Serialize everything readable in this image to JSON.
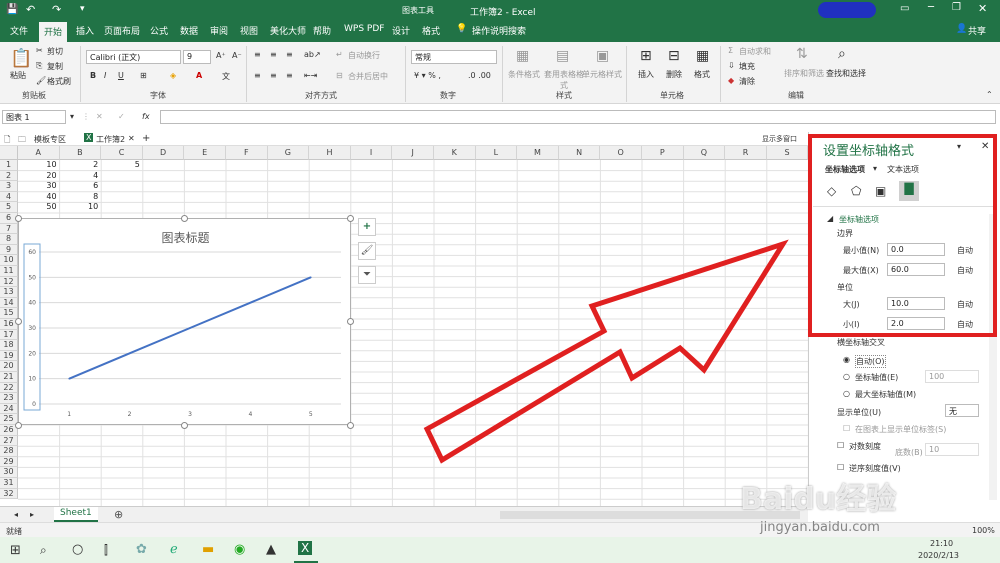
{
  "title": {
    "context_tab": "图表工具",
    "doc_title": "工作簿2 - Excel"
  },
  "tabs": [
    "文件",
    "开始",
    "插入",
    "页面布局",
    "公式",
    "数据",
    "审阅",
    "视图",
    "美化大师",
    "帮助",
    "WPS PDF",
    "设计",
    "格式",
    "操作说明搜索"
  ],
  "share": "共享",
  "ribbon": {
    "clipboard": {
      "paste": "粘贴",
      "cut": "剪切",
      "copy": "复制",
      "format_painter": "格式刷",
      "group": "剪贴板"
    },
    "font": {
      "name": "Calibri (正文)",
      "size": "9",
      "group": "字体"
    },
    "align": {
      "wrap": "自动换行",
      "merge": "合并后居中",
      "group": "对齐方式"
    },
    "number": {
      "format": "常规",
      "group": "数字"
    },
    "styles": {
      "conditional": "条件格式",
      "table": "套用表格格式",
      "cell": "单元格样式",
      "group": "样式"
    },
    "cells": {
      "insert": "插入",
      "delete": "删除",
      "format": "格式",
      "group": "单元格"
    },
    "edit": {
      "autosum": "自动求和",
      "fill": "填充",
      "clear": "清除",
      "sort": "排序和筛选",
      "find": "查找和选择",
      "group": "编辑"
    }
  },
  "formula": {
    "namebox": "图表 1",
    "fx": "fx"
  },
  "doctabs": {
    "template": "模板专区",
    "book": "工作簿2",
    "show_pane": "显示多窗口"
  },
  "columns": [
    "A",
    "B",
    "C",
    "D",
    "E",
    "F",
    "G",
    "H",
    "I",
    "J",
    "K",
    "L",
    "M",
    "N",
    "O",
    "P",
    "Q",
    "R",
    "S"
  ],
  "rows": [
    "1",
    "2",
    "3",
    "4",
    "5",
    "6",
    "7",
    "8",
    "9",
    "10",
    "11",
    "12",
    "13",
    "14",
    "15",
    "16",
    "17",
    "18",
    "19",
    "20",
    "21",
    "22",
    "23",
    "24",
    "25",
    "26",
    "27",
    "28",
    "29",
    "30",
    "31",
    "32"
  ],
  "cells": [
    {
      "r": 1,
      "c": 0,
      "v": "10"
    },
    {
      "r": 1,
      "c": 1,
      "v": "2"
    },
    {
      "r": 1,
      "c": 2,
      "v": "5"
    },
    {
      "r": 2,
      "c": 0,
      "v": "20"
    },
    {
      "r": 2,
      "c": 1,
      "v": "4"
    },
    {
      "r": 3,
      "c": 0,
      "v": "30"
    },
    {
      "r": 3,
      "c": 1,
      "v": "6"
    },
    {
      "r": 4,
      "c": 0,
      "v": "40"
    },
    {
      "r": 4,
      "c": 1,
      "v": "8"
    },
    {
      "r": 5,
      "c": 0,
      "v": "50"
    },
    {
      "r": 5,
      "c": 1,
      "v": "10"
    }
  ],
  "chart_data": {
    "type": "line",
    "title": "图表标题",
    "x": [
      1,
      2,
      3,
      4,
      5
    ],
    "categories": [
      "1",
      "2",
      "3",
      "4",
      "5"
    ],
    "series": [
      {
        "values": [
          10,
          20,
          30,
          40,
          50
        ]
      }
    ],
    "yticks": [
      "0",
      "10",
      "20",
      "30",
      "40",
      "50",
      "60"
    ],
    "ylim": [
      0,
      60
    ],
    "grid": true,
    "line_color": "#4472c4"
  },
  "pane": {
    "title": "设置坐标轴格式",
    "tab_axis": "坐标轴选项",
    "tab_text": "文本选项",
    "section": "坐标轴选项",
    "bounds": "边界",
    "min_label": "最小值(N)",
    "min_value": "0.0",
    "min_auto": "自动",
    "max_label": "最大值(X)",
    "max_value": "60.0",
    "max_auto": "自动",
    "units": "单位",
    "major_label": "大(J)",
    "major_value": "10.0",
    "major_auto": "自动",
    "minor_label": "小(I)",
    "minor_value": "2.0",
    "minor_auto": "自动",
    "cross": "横坐标轴交叉",
    "cross_auto": "自动(O)",
    "cross_value": "坐标轴值(E)",
    "cross_value_num": "100",
    "cross_max": "最大坐标轴值(M)",
    "display_units": "显示单位(U)",
    "display_units_value": "无",
    "show_label": "在图表上显示单位标签(S)",
    "log": "对数刻度",
    "log_base_label": "底数(B)",
    "log_base": "10",
    "reverse": "逆序刻度值(V)"
  },
  "sheet": {
    "name": "Sheet1"
  },
  "status": {
    "ready": "就绪",
    "zoom": "100%"
  },
  "taskbar": {
    "time": "21:10",
    "date": "2020/2/13"
  },
  "watermark": {
    "main": "Baidu经验",
    "url": "jingyan.baidu.com"
  },
  "colors": {
    "excel_green": "#217346",
    "highlight": "#e02020"
  }
}
